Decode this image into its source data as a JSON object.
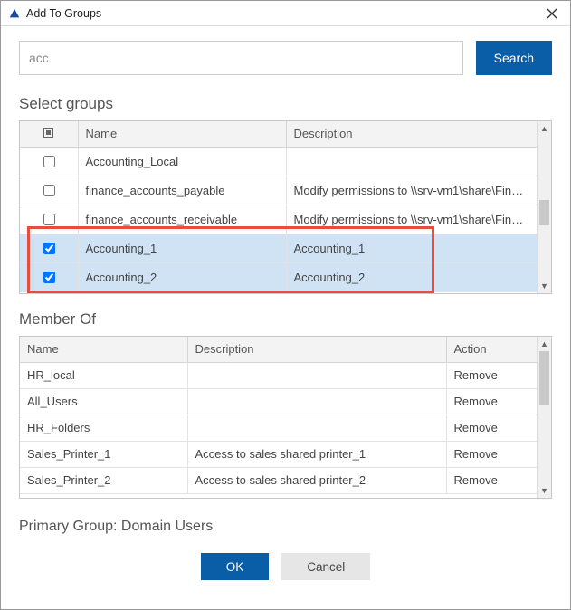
{
  "window": {
    "title": "Add To Groups"
  },
  "search": {
    "value": "acc",
    "button": "Search"
  },
  "select_groups": {
    "title": "Select groups",
    "columns": {
      "name": "Name",
      "description": "Description"
    },
    "rows": [
      {
        "checked": false,
        "selected": false,
        "name": "Accounting_Local",
        "description": ""
      },
      {
        "checked": false,
        "selected": false,
        "name": "finance_accounts_payable",
        "description": "Modify permissions to \\\\srv-vm1\\share\\Finance..."
      },
      {
        "checked": false,
        "selected": false,
        "name": "finance_accounts_receivable",
        "description": "Modify permissions to \\\\srv-vm1\\share\\Finance..."
      },
      {
        "checked": true,
        "selected": true,
        "name": "Accounting_1",
        "description": "Accounting_1"
      },
      {
        "checked": true,
        "selected": true,
        "name": "Accounting_2",
        "description": "Accounting_2"
      }
    ]
  },
  "member_of": {
    "title": "Member Of",
    "columns": {
      "name": "Name",
      "description": "Description",
      "action": "Action"
    },
    "rows": [
      {
        "name": "HR_local",
        "description": "",
        "action": "Remove"
      },
      {
        "name": "All_Users",
        "description": "",
        "action": "Remove"
      },
      {
        "name": "HR_Folders",
        "description": "",
        "action": "Remove"
      },
      {
        "name": "Sales_Printer_1",
        "description": "Access to sales shared printer_1",
        "action": "Remove"
      },
      {
        "name": "Sales_Printer_2",
        "description": "Access to sales shared printer_2",
        "action": "Remove"
      }
    ]
  },
  "primary_group": {
    "label": "Primary Group: Domain Users"
  },
  "footer": {
    "ok": "OK",
    "cancel": "Cancel"
  }
}
